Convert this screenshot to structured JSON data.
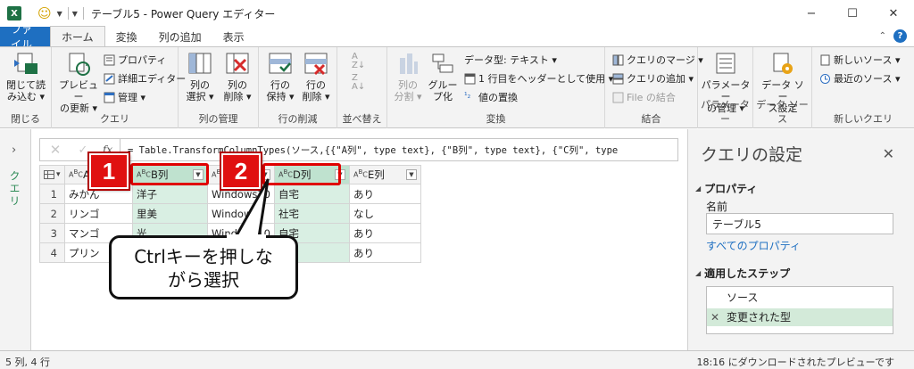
{
  "titlebar": {
    "app_icon": "X",
    "title": "テーブル5 - Power Query エディター",
    "minimize": "−",
    "maximize": "☐",
    "close": "✕"
  },
  "tabs": [
    {
      "label": "ファイル"
    },
    {
      "label": "ホーム"
    },
    {
      "label": "変換"
    },
    {
      "label": "列の追加"
    },
    {
      "label": "表示"
    }
  ],
  "ribbon": {
    "close_group": {
      "label": "閉じる",
      "close_load": "閉じて読\nみ込む ▾"
    },
    "query_group": {
      "label": "クエリ",
      "preview_refresh": "プレビュー\nの更新 ▾",
      "properties": "プロパティ",
      "advanced_editor": "詳細エディター",
      "manage": "管理 ▾"
    },
    "columns_group": {
      "label": "列の管理",
      "select_columns": "列の\n選択 ▾",
      "remove_columns": "列の\n削除 ▾"
    },
    "rows_group": {
      "label": "行の削減",
      "keep_rows": "行の\n保持 ▾",
      "remove_rows": "行の\n削除 ▾"
    },
    "sort_group": {
      "label": "並べ替え"
    },
    "transform_group": {
      "label": "変換",
      "split_column": "列の\n分割 ▾",
      "group_by": "グルー\nプ化",
      "data_type": "データ型: テキスト ▾",
      "first_row_header": "1 行目をヘッダーとして使用 ▾",
      "replace_values": "値の置換"
    },
    "combine_group": {
      "label": "結合",
      "merge_queries": "クエリのマージ ▾",
      "append_queries": "クエリの追加 ▾",
      "combine_files": "File の結合"
    },
    "params_group": {
      "label": "パラメーター",
      "manage_params": "パラメーター\nの管理 ▾"
    },
    "datasource_group": {
      "label": "データ ソース",
      "datasource_settings": "データ ソー\nス設定"
    },
    "newquery_group": {
      "label": "新しいクエリ",
      "new_source": "新しいソース ▾",
      "recent_sources": "最近のソース ▾"
    }
  },
  "left_pane": {
    "label": "クエリ",
    "chevron": "›"
  },
  "formula_bar": {
    "cancel": "✕",
    "commit": "✓",
    "fx": "fx",
    "formula": "= Table.TransformColumnTypes(ソース,{{\"A列\", type text}, {\"B列\", type text}, {\"C列\", type"
  },
  "grid": {
    "type_icon": "ABC",
    "columns": [
      "A列",
      "B列",
      "C列",
      "D列",
      "E列"
    ],
    "rows": [
      {
        "n": "1",
        "cells": [
          "みかん",
          "洋子",
          "Windows10",
          "自宅",
          "あり"
        ]
      },
      {
        "n": "2",
        "cells": [
          "リンゴ",
          "里美",
          "Windows7",
          "社宅",
          "なし"
        ]
      },
      {
        "n": "3",
        "cells": [
          "マンゴ",
          "光",
          "Windows10",
          "自宅",
          "あり"
        ]
      },
      {
        "n": "4",
        "cells": [
          "プリン",
          "",
          "",
          "",
          "あり"
        ]
      }
    ]
  },
  "annotations": {
    "badge1": "1",
    "badge2": "2",
    "callout_line1": "Ctrlキーを押しな",
    "callout_line2": "がら選択"
  },
  "right_pane": {
    "title": "クエリの設定",
    "close": "✕",
    "properties_header": "プロパティ",
    "name_label": "名前",
    "name_value": "テーブル5",
    "all_properties": "すべてのプロパティ",
    "applied_steps_header": "適用したステップ",
    "steps": [
      "ソース",
      "変更された型"
    ]
  },
  "status_bar": {
    "left": "5 列, 4 行",
    "right": "18:16 にダウンロードされたプレビューです"
  },
  "colors": {
    "file_tab": "#1e6fc1",
    "selected_column": "#d9efe3",
    "annotation_red": "#e00000",
    "link": "#1e6fc1"
  }
}
